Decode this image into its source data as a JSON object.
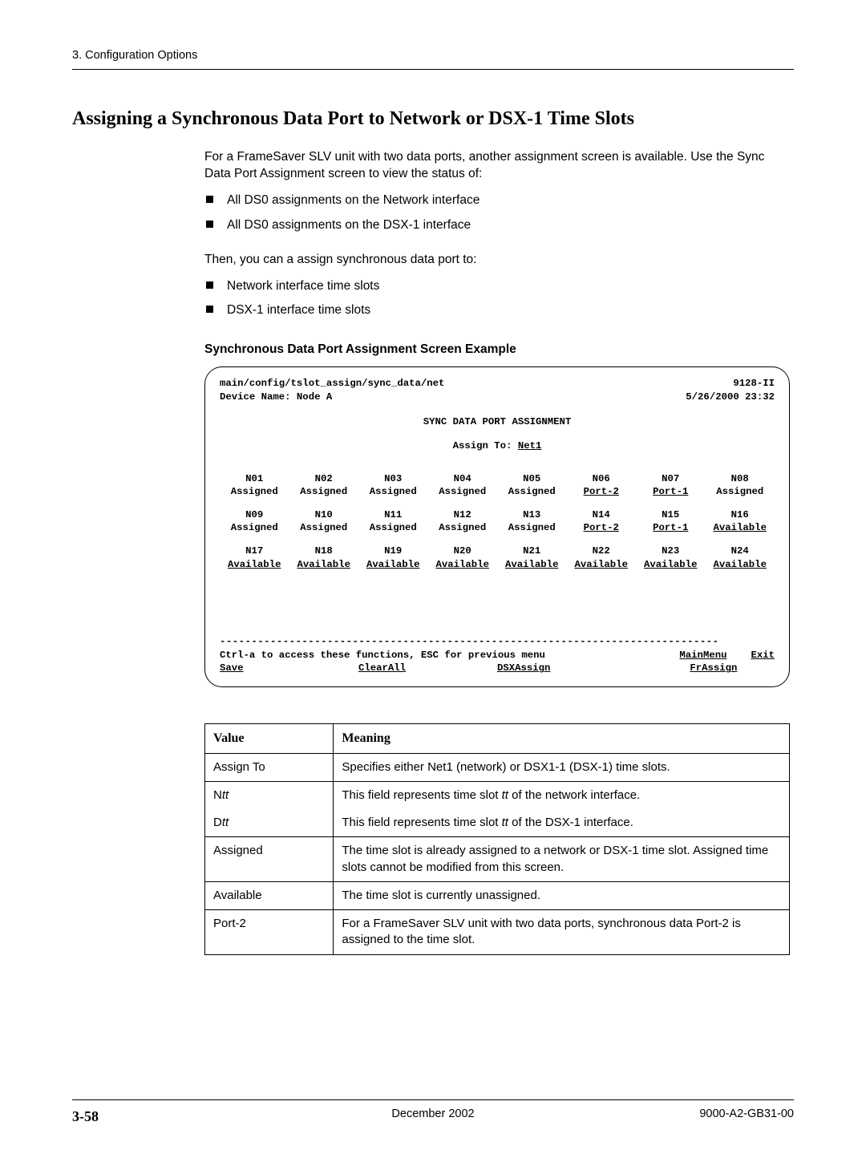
{
  "header": {
    "section": "3. Configuration Options"
  },
  "title": "Assigning a Synchronous Data Port to Network or DSX-1 Time Slots",
  "intro": "For a FrameSaver SLV unit with two data ports, another assignment screen is available. Use the Sync Data Port Assignment screen to view the status of:",
  "bullets1": [
    "All DS0 assignments on the Network interface",
    "All DS0 assignments on the DSX-1 interface"
  ],
  "then": "Then, you can a assign synchronous data port to:",
  "bullets2": [
    "Network interface time slots",
    "DSX-1 interface time slots"
  ],
  "subhead": "Synchronous Data Port Assignment Screen Example",
  "screen": {
    "path": "main/config/tslot_assign/sync_data/net",
    "model": "9128-II",
    "device_label": "Device Name: Node A",
    "datetime": "5/26/2000 23:32",
    "title": "SYNC DATA PORT ASSIGNMENT",
    "assign_label": "Assign To:",
    "assign_value": "Net1  ",
    "rows": [
      {
        "labels": [
          "N01",
          "N02",
          "N03",
          "N04",
          "N05",
          "N06",
          "N07",
          "N08"
        ],
        "values": [
          "Assigned",
          "Assigned",
          "Assigned",
          "Assigned",
          "Assigned",
          "Port-2  ",
          "Port-1  ",
          "Assigned"
        ],
        "underline": [
          false,
          false,
          false,
          false,
          false,
          true,
          true,
          false
        ]
      },
      {
        "labels": [
          "N09",
          "N10",
          "N11",
          "N12",
          "N13",
          "N14",
          "N15",
          "N16"
        ],
        "values": [
          "Assigned",
          "Assigned",
          "Assigned",
          "Assigned",
          "Assigned",
          "Port-2  ",
          "Port-1  ",
          "Available"
        ],
        "underline": [
          false,
          false,
          false,
          false,
          false,
          true,
          true,
          true
        ]
      },
      {
        "labels": [
          "N17",
          "N18",
          "N19",
          "N20",
          "N21",
          "N22",
          "N23",
          "N24"
        ],
        "values": [
          "Available",
          "Available",
          "Available",
          "Available",
          "Available",
          "Available",
          "Available",
          "Available"
        ],
        "underline": [
          true,
          true,
          true,
          true,
          true,
          true,
          true,
          true
        ]
      }
    ],
    "help": "Ctrl-a to access these functions, ESC for previous menu",
    "fn_main": "MainMenu",
    "fn_exit": "Exit",
    "fn_save": "Save",
    "fn_clear": "ClearAll",
    "fn_dsx": "DSXAssign   ",
    "fn_fr": "FrAssign"
  },
  "table": {
    "h1": "Value",
    "h2": "Meaning",
    "rows": [
      {
        "v": "Assign To",
        "m": "Specifies either Net1 (network) or DSX1-1 (DSX-1) time slots.",
        "group": 0
      },
      {
        "v_pre": "N",
        "v_it": "tt",
        "m_pre": "This field represents time slot ",
        "m_it": "tt",
        "m_post": " of the network interface.",
        "group": 1
      },
      {
        "v_pre": "D",
        "v_it": "tt",
        "m_pre": "This field represents time slot ",
        "m_it": "tt",
        "m_post": " of the DSX-1 interface.",
        "group": 1
      },
      {
        "v": "Assigned",
        "m": "The time slot is already assigned to a network or DSX-1 time slot. Assigned time slots cannot be modified from this screen.",
        "group": 2
      },
      {
        "v": "Available",
        "m": "The time slot is currently unassigned.",
        "group": 3
      },
      {
        "v": "Port-2",
        "m": "For a FrameSaver SLV unit with two data ports, synchronous data Port-2 is assigned to the time slot.",
        "group": 4
      }
    ]
  },
  "footer": {
    "page": "3-58",
    "date": "December 2002",
    "doc": "9000-A2-GB31-00"
  }
}
